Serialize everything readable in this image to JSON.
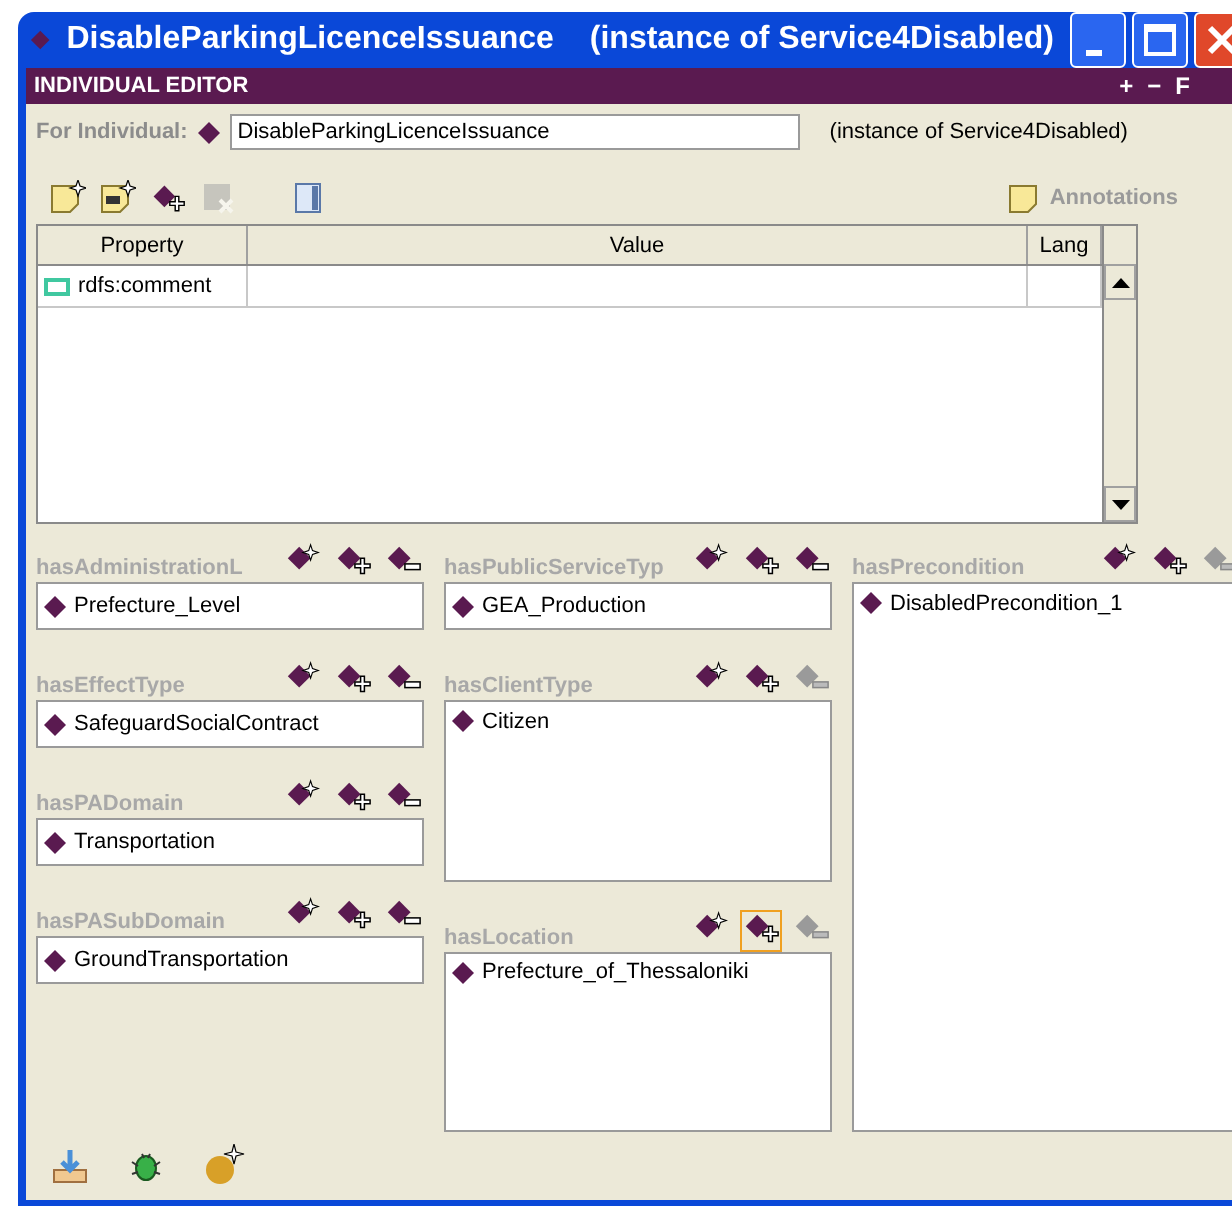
{
  "window": {
    "title": "DisableParkingLicenceIssuance",
    "subtitle": "(instance of Service4Disabled)"
  },
  "header": {
    "title": "INDIVIDUAL EDITOR",
    "controls": [
      "+",
      "−",
      "F"
    ]
  },
  "individual": {
    "label": "For Individual:",
    "value": "DisableParkingLicenceIssuance",
    "type": "(instance of Service4Disabled)"
  },
  "toolbar": [
    {
      "kind": "new",
      "disabled": false
    },
    {
      "kind": "newdoc",
      "disabled": false
    },
    {
      "kind": "add",
      "disabled": false
    },
    {
      "kind": "remove",
      "disabled": true
    },
    {
      "kind": "columns",
      "disabled": false
    }
  ],
  "annotations": {
    "label": "Annotations"
  },
  "table": {
    "columns": [
      "Property",
      "Value",
      "Lang"
    ],
    "rows": [
      {
        "property": "rdfs:comment",
        "value": "",
        "lang": ""
      }
    ]
  },
  "slot_columns": [
    [
      {
        "label": "hasAdministrationL",
        "kind": "single",
        "values": [
          "Prefecture_Level"
        ],
        "actions": [
          {
            "kind": "create",
            "disabled": false,
            "selected": false
          },
          {
            "kind": "add",
            "disabled": false,
            "selected": false
          },
          {
            "kind": "remove",
            "disabled": false,
            "selected": false
          }
        ]
      },
      {
        "label": "hasEffectType",
        "kind": "single",
        "values": [
          "SafeguardSocialContract"
        ],
        "actions": [
          {
            "kind": "create",
            "disabled": false,
            "selected": false
          },
          {
            "kind": "add",
            "disabled": false,
            "selected": false
          },
          {
            "kind": "remove",
            "disabled": false,
            "selected": false
          }
        ]
      },
      {
        "label": "hasPADomain",
        "kind": "single",
        "values": [
          "Transportation"
        ],
        "actions": [
          {
            "kind": "create",
            "disabled": false,
            "selected": false
          },
          {
            "kind": "add",
            "disabled": false,
            "selected": false
          },
          {
            "kind": "remove",
            "disabled": false,
            "selected": false
          }
        ]
      },
      {
        "label": "hasPASubDomain",
        "kind": "single",
        "values": [
          "GroundTransportation"
        ],
        "actions": [
          {
            "kind": "create",
            "disabled": false,
            "selected": false
          },
          {
            "kind": "add",
            "disabled": false,
            "selected": false
          },
          {
            "kind": "remove",
            "disabled": false,
            "selected": false
          }
        ]
      }
    ],
    [
      {
        "label": "hasPublicServiceTyp",
        "kind": "single",
        "values": [
          "GEA_Production"
        ],
        "actions": [
          {
            "kind": "create",
            "disabled": false,
            "selected": false
          },
          {
            "kind": "add",
            "disabled": false,
            "selected": false
          },
          {
            "kind": "remove",
            "disabled": false,
            "selected": false
          }
        ]
      },
      {
        "label": "hasClientType",
        "kind": "list",
        "values": [
          "Citizen"
        ],
        "actions": [
          {
            "kind": "create",
            "disabled": false,
            "selected": false
          },
          {
            "kind": "add",
            "disabled": false,
            "selected": false
          },
          {
            "kind": "remove",
            "disabled": true,
            "selected": false
          }
        ]
      },
      {
        "label": "hasLocation",
        "kind": "list",
        "values": [
          "Prefecture_of_Thessaloniki"
        ],
        "actions": [
          {
            "kind": "create",
            "disabled": false,
            "selected": false
          },
          {
            "kind": "add",
            "disabled": false,
            "selected": true
          },
          {
            "kind": "remove",
            "disabled": true,
            "selected": false
          }
        ]
      }
    ],
    [
      {
        "label": "hasPrecondition",
        "kind": "list",
        "values": [
          "DisabledPrecondition_1"
        ],
        "actions": [
          {
            "kind": "create",
            "disabled": false,
            "selected": false
          },
          {
            "kind": "add",
            "disabled": false,
            "selected": false
          },
          {
            "kind": "remove",
            "disabled": true,
            "selected": false
          }
        ]
      }
    ]
  ],
  "footer": [
    {
      "kind": "import"
    },
    {
      "kind": "bug"
    },
    {
      "kind": "new-instance"
    }
  ]
}
